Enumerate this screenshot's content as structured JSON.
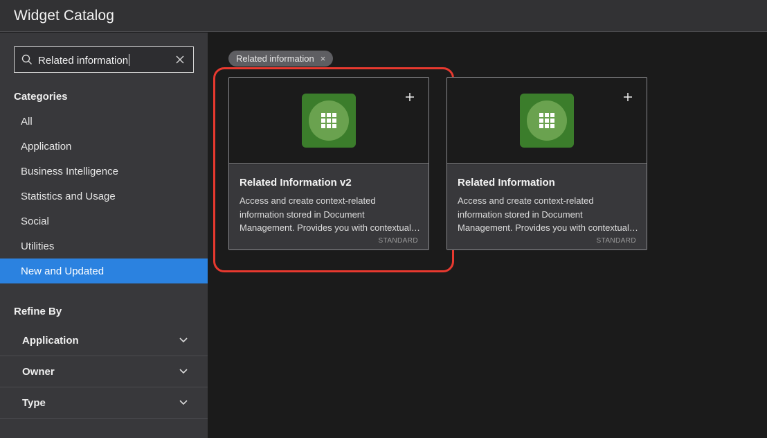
{
  "header": {
    "title": "Widget Catalog"
  },
  "search": {
    "value": "Related information",
    "clear_icon": "close-icon",
    "icon": "search-icon"
  },
  "categories": {
    "title": "Categories",
    "items": [
      {
        "label": "All",
        "active": false
      },
      {
        "label": "Application",
        "active": false
      },
      {
        "label": "Business Intelligence",
        "active": false
      },
      {
        "label": "Statistics and Usage",
        "active": false
      },
      {
        "label": "Social",
        "active": false
      },
      {
        "label": "Utilities",
        "active": false
      },
      {
        "label": "New and Updated",
        "active": true
      }
    ]
  },
  "refine": {
    "title": "Refine By",
    "items": [
      {
        "label": "Application"
      },
      {
        "label": "Owner"
      },
      {
        "label": "Type"
      }
    ]
  },
  "filter_chip": {
    "label": "Related information",
    "remove": "×"
  },
  "cards": [
    {
      "name": "Related Information v2",
      "description": "Access and create context-related information stored in Document Management. Provides you with contextual information",
      "type": "STANDARD",
      "highlighted": true
    },
    {
      "name": "Related Information",
      "description": "Access and create context-related information stored in Document Management. Provides you with contextual information",
      "type": "STANDARD",
      "highlighted": false
    }
  ],
  "colors": {
    "accent": "#2b82e0",
    "highlight": "#e8392f",
    "icon_bg": "#3b7d2b",
    "icon_circle": "#6aa24f"
  }
}
